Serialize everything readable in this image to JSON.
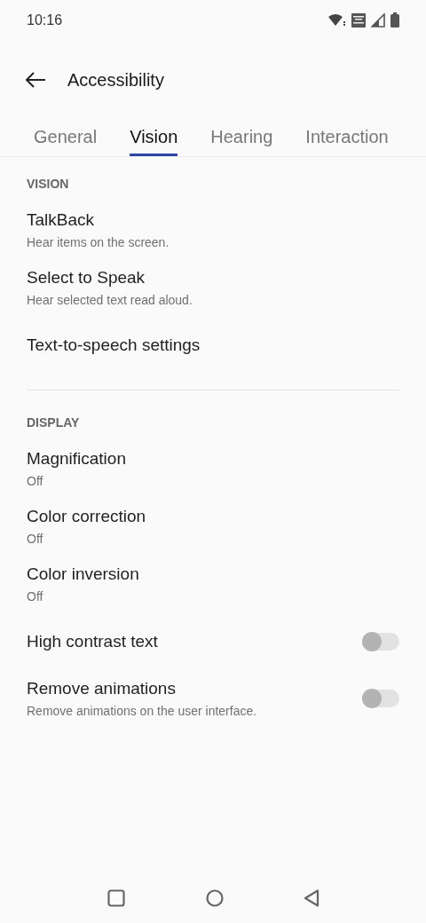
{
  "status_bar": {
    "time": "10:16"
  },
  "header": {
    "title": "Accessibility"
  },
  "tabs": [
    {
      "label": "General",
      "selected": false
    },
    {
      "label": "Vision",
      "selected": true
    },
    {
      "label": "Hearing",
      "selected": false
    },
    {
      "label": "Interaction",
      "selected": false
    }
  ],
  "sections": [
    {
      "heading": "VISION",
      "items": [
        {
          "kind": "link",
          "title": "TalkBack",
          "summary": "Hear items on the screen."
        },
        {
          "kind": "link",
          "title": "Select to Speak",
          "summary": "Hear selected text read aloud."
        },
        {
          "kind": "link",
          "title": "Text-to-speech settings"
        }
      ]
    },
    {
      "heading": "DISPLAY",
      "items": [
        {
          "kind": "link",
          "title": "Magnification",
          "summary": "Off"
        },
        {
          "kind": "link",
          "title": "Color correction",
          "summary": "Off"
        },
        {
          "kind": "link",
          "title": "Color inversion",
          "summary": "Off"
        },
        {
          "kind": "toggle",
          "title": "High contrast text",
          "on": false
        },
        {
          "kind": "toggle",
          "title": "Remove animations",
          "summary": "Remove animations on the user interface.",
          "on": false
        }
      ]
    }
  ]
}
